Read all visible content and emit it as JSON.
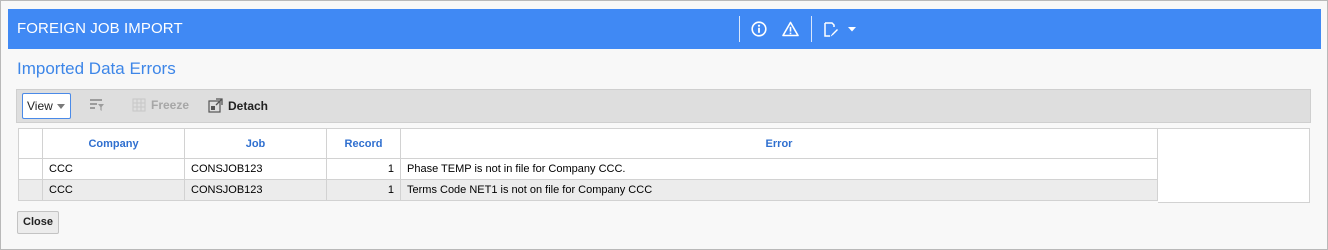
{
  "window": {
    "title": "FOREIGN JOB IMPORT"
  },
  "header_icons": [
    "info-icon",
    "warning-icon",
    "edit-note-icon",
    "dropdown-caret-icon"
  ],
  "section": {
    "title": "Imported Data Errors"
  },
  "toolbar": {
    "view_label": "View",
    "freeze_label": "Freeze",
    "detach_label": "Detach"
  },
  "grid": {
    "columns": [
      "Company",
      "Job",
      "Record",
      "Error"
    ],
    "rows": [
      {
        "company": "CCC",
        "job": "CONSJOB123",
        "record": "1",
        "error": "Phase TEMP is not in file for Company CCC."
      },
      {
        "company": "CCC",
        "job": "CONSJOB123",
        "record": "1",
        "error": "Terms Code NET1 is not on file for Company CCC"
      }
    ]
  },
  "footer": {
    "close_label": "Close"
  },
  "colors": {
    "titlebar": "#4089f4",
    "section_title": "#3d86e8",
    "column_header": "#2f6fcf"
  }
}
